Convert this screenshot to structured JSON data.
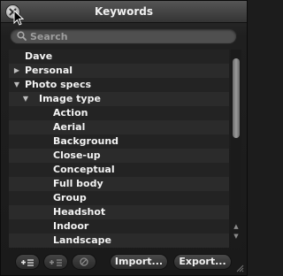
{
  "window": {
    "title": "Keywords"
  },
  "search": {
    "placeholder": "Search"
  },
  "keywords": [
    {
      "label": "Dave",
      "expander": "",
      "level": 0
    },
    {
      "label": "Personal",
      "expander": "▶",
      "level": 0
    },
    {
      "label": "Photo specs",
      "expander": "▼",
      "level": 0
    },
    {
      "label": "Image type",
      "expander": "▼",
      "level": 1
    },
    {
      "label": "Action",
      "expander": "",
      "level": 2
    },
    {
      "label": "Aerial",
      "expander": "",
      "level": 2
    },
    {
      "label": "Background",
      "expander": "",
      "level": 2
    },
    {
      "label": "Close-up",
      "expander": "",
      "level": 2
    },
    {
      "label": "Conceptual",
      "expander": "",
      "level": 2
    },
    {
      "label": "Full body",
      "expander": "",
      "level": 2
    },
    {
      "label": "Group",
      "expander": "",
      "level": 2
    },
    {
      "label": "Headshot",
      "expander": "",
      "level": 2
    },
    {
      "label": "Indoor",
      "expander": "",
      "level": 2
    },
    {
      "label": "Landscape",
      "expander": "",
      "level": 2
    }
  ],
  "buttons": {
    "add_keyword_icon": "add-keyword-icon",
    "add_subkeyword_icon": "add-subkeyword-icon",
    "remove_icon": "remove-keyword-icon",
    "import_label": "Import...",
    "export_label": "Export..."
  }
}
